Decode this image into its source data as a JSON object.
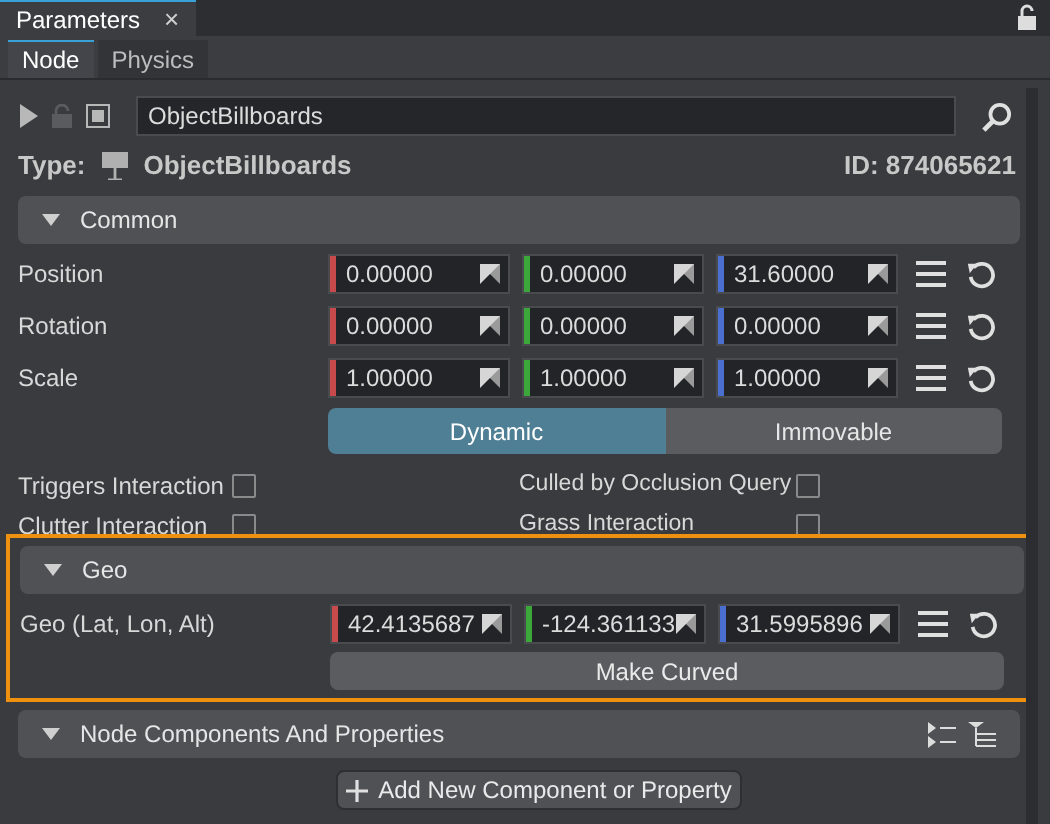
{
  "window": {
    "tab": "Parameters",
    "close": "×"
  },
  "tabs": [
    {
      "label": "Node",
      "selected": true
    },
    {
      "label": "Physics",
      "selected": false
    }
  ],
  "search": {
    "value": "ObjectBillboards"
  },
  "type": {
    "label": "Type:",
    "name": "ObjectBillboards",
    "id": "ID: 874065621"
  },
  "common": {
    "title": "Common",
    "expanded": true,
    "rows": [
      {
        "label": "Position",
        "values": [
          "0.00000",
          "0.00000",
          "31.60000"
        ]
      },
      {
        "label": "Rotation",
        "values": [
          "0.00000",
          "0.00000",
          "0.00000"
        ]
      },
      {
        "label": "Scale",
        "values": [
          "1.00000",
          "1.00000",
          "1.00000"
        ]
      }
    ],
    "mode": [
      {
        "label": "Dynamic",
        "selected": true
      },
      {
        "label": "Immovable",
        "selected": false
      }
    ],
    "checks": [
      {
        "label": "Triggers Interaction",
        "checked": false
      },
      {
        "label": "Culled by Occlusion Query",
        "checked": false
      },
      {
        "label": "Clutter Interaction",
        "checked": false
      },
      {
        "label": "Grass Interaction",
        "checked": false
      }
    ]
  },
  "geo": {
    "title": "Geo",
    "expanded": true,
    "highlighted": true,
    "row": {
      "label": "Geo (Lat, Lon, Alt)",
      "values": [
        "42.4135687",
        "-124.361133",
        "31.5995896"
      ]
    },
    "button": "Make Curved"
  },
  "components": {
    "title": "Node Components And Properties",
    "expanded": true,
    "button": "Add New Component or Property"
  }
}
